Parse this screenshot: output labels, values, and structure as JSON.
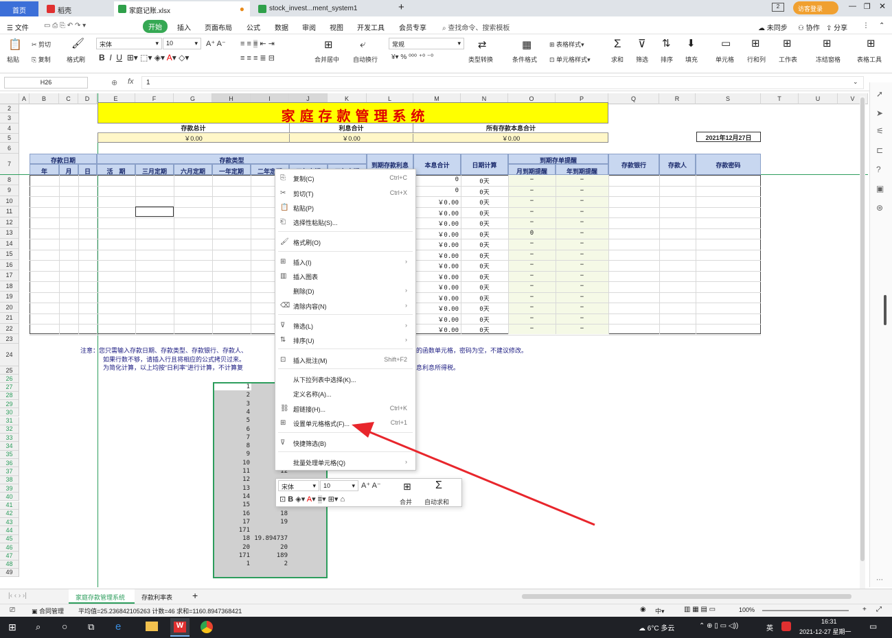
{
  "titlebar": {
    "tabs": [
      "首页",
      "稻壳",
      "家庭记账.xlsx",
      "stock_invest...ment_system1"
    ],
    "login": "访客登录"
  },
  "menubar": {
    "file": "文件",
    "items": [
      "开始",
      "插入",
      "页面布局",
      "公式",
      "数据",
      "审阅",
      "视图",
      "开发工具",
      "会员专享"
    ],
    "search": "查找命令、搜索模板",
    "sync": "未同步",
    "collab": "协作",
    "share": "分享"
  },
  "ribbon": {
    "paste": "粘贴",
    "cut": "剪切",
    "copy": "复制",
    "format_painter": "格式刷",
    "font": "宋体",
    "size": "10",
    "merge": "合并居中",
    "wrap": "自动换行",
    "numfmt": "常规",
    "convert": "类型转换",
    "cond": "条件格式",
    "table_style": "表格样式",
    "cell_style": "单元格样式",
    "sum": "求和",
    "filter": "筛选",
    "sort": "排序",
    "fill": "填充",
    "cells": "单元格",
    "rowcol": "行和列",
    "worksheet": "工作表",
    "freeze": "冻结窗格",
    "tabletools": "表格工具"
  },
  "formula": {
    "name_box": "H26",
    "fx": "fx",
    "value": "1"
  },
  "columns": [
    "A",
    "B",
    "C",
    "D",
    "E",
    "F",
    "G",
    "H",
    "I",
    "J",
    "K",
    "L",
    "M",
    "N",
    "O",
    "P",
    "Q",
    "R",
    "S",
    "T",
    "U",
    "V"
  ],
  "sheet": {
    "title": "家 庭 存 款 管 理 系 统",
    "sum_labels": [
      "存款总计",
      "利息合计",
      "所有存款本息合计"
    ],
    "sum_values": [
      "￥0.00",
      "￥0.00",
      "￥0.00"
    ],
    "date": "2021年12月27日",
    "h_date": "存款日期",
    "h_type": "存款类型",
    "h_interest": "到期存款利息",
    "h_total": "本息合计",
    "h_days": "日期计算",
    "h_remind": "到期存单提醒",
    "h_bank": "存款银行",
    "h_person": "存款人",
    "h_pwd": "存款密码",
    "sub": [
      "年",
      "月",
      "日",
      "活　期",
      "三月定期",
      "六月定期",
      "一年定期",
      "二年定期",
      "三年定期",
      "五年定期"
    ],
    "remind_sub": [
      "月到期提醒",
      "年到期提醒"
    ],
    "notes": [
      "注意：您只需输入存款日期、存款类型、存款银行、存款人、",
      "的函数单元格，密码为空，不建议修改。",
      "如果行数不够，请插入行且将相应的公式拷贝过来。",
      "为简化计算，以上均按“日利率”进行计算，不计算复",
      "息利息所得税。"
    ],
    "amount_cells": [
      "0",
      "0",
      "￥0.00",
      "￥0.00",
      "￥0.00",
      "￥0.00",
      "￥0.00",
      "￥0.00",
      "￥0.00",
      "￥0.00",
      "￥0.00",
      "￥0.00",
      "￥0.00",
      "￥0.00",
      "￥0.00"
    ],
    "days": "0天",
    "dash": "−",
    "zero": "0",
    "sel_h": [
      "1",
      "2",
      "3",
      "4",
      "5",
      "6",
      "7",
      "8",
      "9",
      "10",
      "11",
      "12",
      "13",
      "14",
      "15",
      "16",
      "17",
      "171",
      "18",
      "20",
      "171",
      "1"
    ],
    "sel_i": [
      "",
      "",
      "",
      "",
      "",
      "",
      "",
      "",
      "",
      "",
      "12",
      "",
      "",
      "16",
      "17",
      "18",
      "19",
      "",
      "19.894737",
      "20",
      "189",
      "2"
    ]
  },
  "context_menu": [
    {
      "label": "复制(C)",
      "shortcut": "Ctrl+C"
    },
    {
      "label": "剪切(T)",
      "shortcut": "Ctrl+X"
    },
    {
      "label": "粘贴(P)",
      "shortcut": ""
    },
    {
      "label": "选择性粘贴(S)...",
      "shortcut": ""
    },
    {
      "label": "格式刷(O)",
      "shortcut": ""
    },
    {
      "label": "插入(I)",
      "shortcut": "›"
    },
    {
      "label": "插入图表",
      "shortcut": ""
    },
    {
      "label": "删除(D)",
      "shortcut": "›"
    },
    {
      "label": "清除内容(N)",
      "shortcut": "›"
    },
    {
      "label": "筛选(L)",
      "shortcut": "›"
    },
    {
      "label": "排序(U)",
      "shortcut": "›"
    },
    {
      "label": "插入批注(M)",
      "shortcut": "Shift+F2"
    },
    {
      "label": "从下拉列表中选择(K)...",
      "shortcut": ""
    },
    {
      "label": "定义名称(A)...",
      "shortcut": ""
    },
    {
      "label": "超链接(H)...",
      "shortcut": "Ctrl+K"
    },
    {
      "label": "设置单元格格式(F)...",
      "shortcut": "Ctrl+1"
    },
    {
      "label": "快捷筛选(B)",
      "shortcut": ""
    },
    {
      "label": "批量处理单元格(Q)",
      "shortcut": "›"
    }
  ],
  "minitb": {
    "font": "宋体",
    "size": "10",
    "merge": "合并",
    "autosum": "自动求和"
  },
  "sheettabs": [
    "家庭存款管理系统",
    "存款利率表"
  ],
  "status": {
    "contract": "合同管理",
    "stats": "平均值=25.236842105263  计数=46  求和=1160.8947368421",
    "zoom": "100%",
    "ime": "中"
  },
  "taskbar": {
    "weather": "6°C 多云",
    "lang": "英",
    "time": "16:31",
    "date": "2021-12-27 星期一"
  },
  "colors": {
    "title_bg": "#ffff00",
    "title_fg": "#e00000",
    "header_bg": "#c8d7f0",
    "arrow": "#e8262c",
    "accent_green": "#35a853"
  }
}
